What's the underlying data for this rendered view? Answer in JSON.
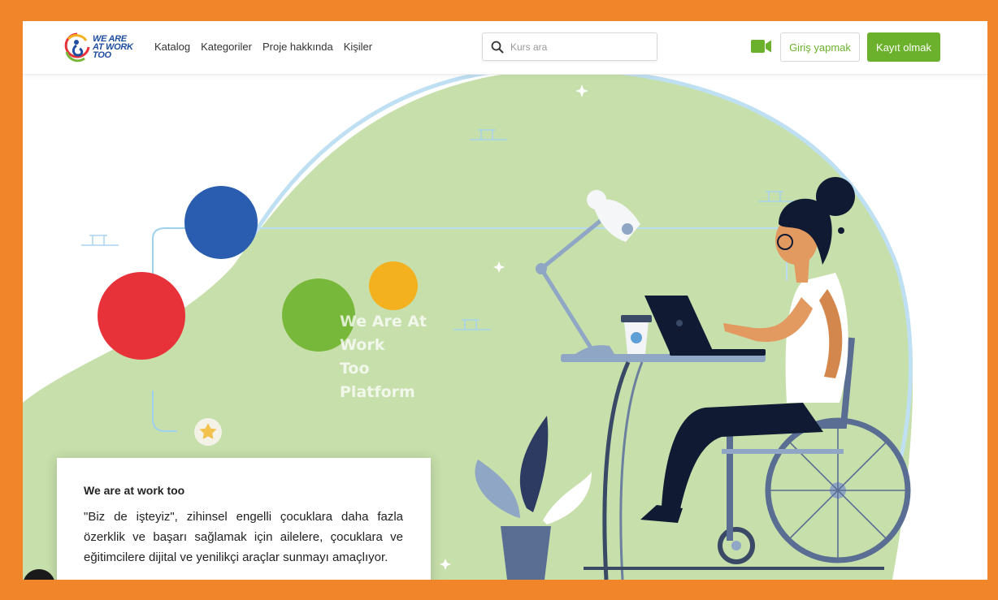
{
  "brand": {
    "logo_lines": [
      "WE ARE",
      "AT WORK",
      "TOO"
    ],
    "primary_color": "#1f4ea1",
    "accent_green": "#6bb12b",
    "frame_orange": "#f0852a"
  },
  "nav": {
    "items": [
      {
        "label": "Katalog"
      },
      {
        "label": "Kategoriler"
      },
      {
        "label": "Proje hakkında"
      },
      {
        "label": "Kişiler"
      }
    ]
  },
  "search": {
    "placeholder": "Kurs ara",
    "value": "",
    "icon": "search-icon"
  },
  "header_actions": {
    "video_icon": "video-camera-icon",
    "login_label": "Giriş yapmak",
    "register_label": "Kayıt olmak"
  },
  "hero": {
    "title_lines": [
      "We Are At",
      "Work",
      "Too",
      "Platform"
    ],
    "circle_colors": [
      "#2a5db0",
      "#e8323a",
      "#77b83a",
      "#f3b11f"
    ],
    "blob_color": "#c7dfab"
  },
  "card": {
    "title": "We are at work too",
    "body": "\"Biz de işteyiz\", zihinsel engelli çocuklara daha fazla özerklik ve başarı sağlamak için ailelere, çocuklara ve eğitimcilere dijital ve yenilikçi araçlar sunmayı amaçlıyor."
  }
}
